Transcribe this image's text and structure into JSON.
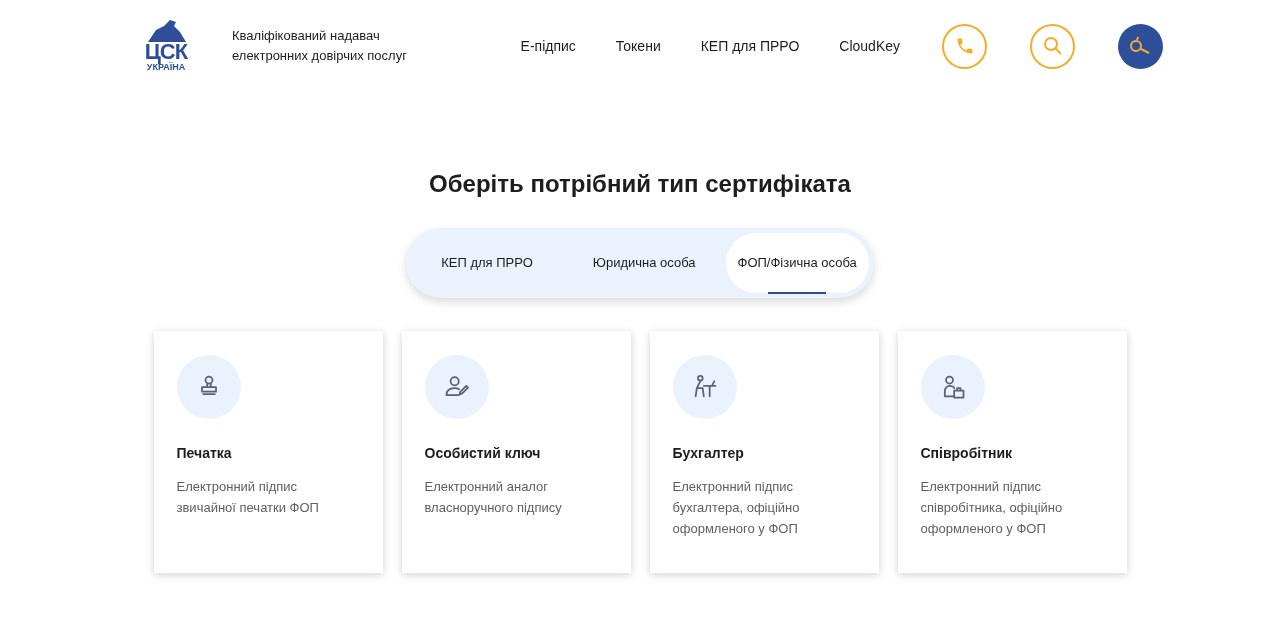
{
  "header": {
    "logo": {
      "main": "ЦСК",
      "sub": "УКРАЇНА"
    },
    "tagline": "Кваліфікований надавач електронних довірчих послуг",
    "nav": [
      "Е-підпис",
      "Токени",
      "КЕП для ПРРО",
      "CloudKey"
    ]
  },
  "heading": "Оберіть потрібний тип сертифіката",
  "tabs": [
    {
      "label": "КЕП для ПРРО",
      "selected": false
    },
    {
      "label": "Юридична особа",
      "selected": false
    },
    {
      "label": "ФОП/Фізична особа",
      "selected": true
    }
  ],
  "cards": [
    {
      "kind": "stamp",
      "title": "Печатка",
      "description": "Електронний підпис звичайної печатки ФОП"
    },
    {
      "kind": "signer",
      "title": "Особистий ключ",
      "description": "Електронний аналог власноручного підпису"
    },
    {
      "kind": "desk",
      "title": "Бухгалтер",
      "description": "Електронний підпис бухгалтера, офіційно оформленого у ФОП"
    },
    {
      "kind": "worker",
      "title": "Співробітник",
      "description": "Електронний підпис співробітника, офіційно оформленого у ФОП"
    }
  ]
}
